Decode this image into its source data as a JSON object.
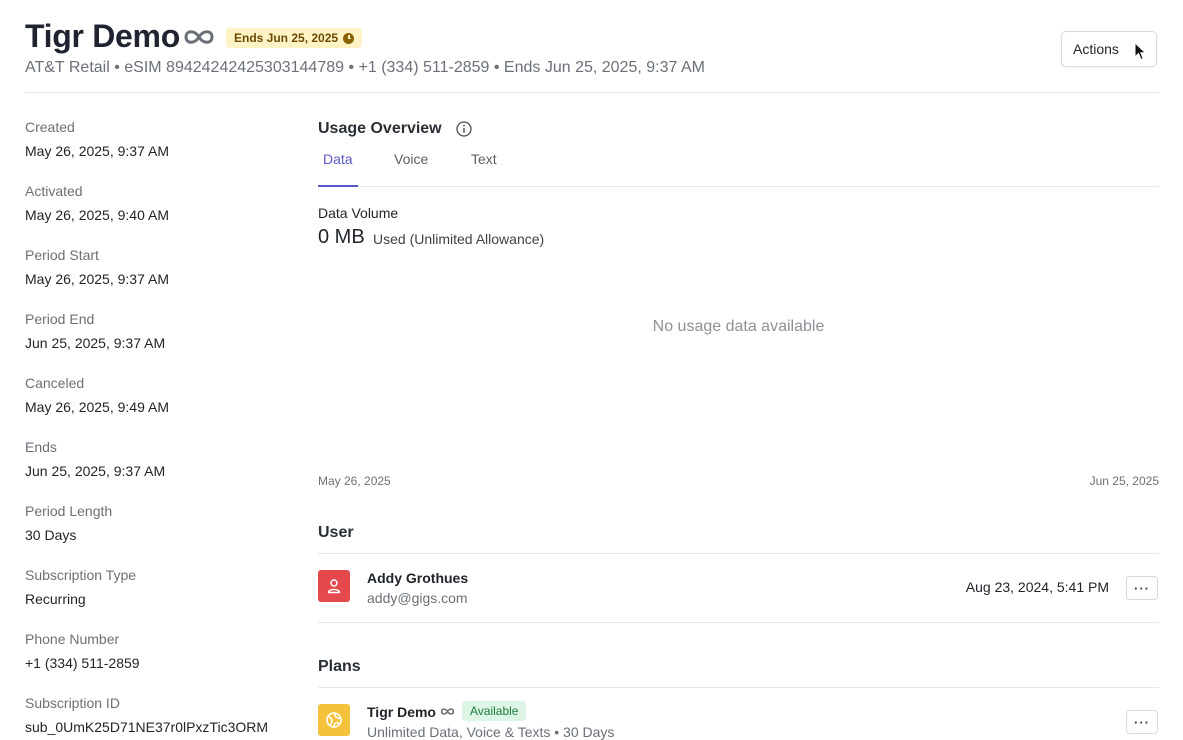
{
  "header": {
    "title": "Tigr Demo",
    "ends_badge": "Ends Jun 25, 2025",
    "subtitle": "AT&T Retail • eSIM 89424242425303144789 • +1 (334) 511-2859 •   Ends Jun 25, 2025, 9:37 AM",
    "actions_label": "Actions",
    "badge_color": "#fdf3c4"
  },
  "details": [
    {
      "label": "Created",
      "value": "May 26, 2025, 9:37 AM"
    },
    {
      "label": "Activated",
      "value": "May 26, 2025, 9:40 AM"
    },
    {
      "label": "Period Start",
      "value": "May 26, 2025, 9:37 AM"
    },
    {
      "label": "Period End",
      "value": "Jun 25, 2025, 9:37 AM"
    },
    {
      "label": "Canceled",
      "value": "May 26, 2025, 9:49 AM"
    },
    {
      "label": "Ends",
      "value": "Jun 25, 2025, 9:37 AM"
    },
    {
      "label": "Period Length",
      "value": "30 Days"
    },
    {
      "label": "Subscription Type",
      "value": "Recurring"
    },
    {
      "label": "Phone Number",
      "value": "+1 (334) 511-2859"
    },
    {
      "label": "Subscription ID",
      "value": "sub_0UmK25D71NE37r0lPxzTic3ORM"
    }
  ],
  "usage": {
    "title": "Usage Overview",
    "tabs": [
      {
        "label": "Data",
        "active": true
      },
      {
        "label": "Voice",
        "active": false
      },
      {
        "label": "Text",
        "active": false
      }
    ],
    "volume_label": "Data Volume",
    "volume_value": "0 MB",
    "volume_suffix": "Used (Unlimited Allowance)",
    "empty_message": "No usage data available",
    "axis_start": "May 26, 2025",
    "axis_end": "Jun 25, 2025",
    "accent_color": "#5b57c9"
  },
  "user_section": {
    "title": "User",
    "name": "Addy Grothues",
    "email": "addy@gigs.com",
    "date": "Aug 23, 2024, 5:41 PM",
    "more_label": "···",
    "avatar_color": "#e5484d"
  },
  "plans_section": {
    "title": "Plans",
    "name": "Tigr Demo",
    "status": "Available",
    "description": "Unlimited Data, Voice & Texts • 30 Days",
    "more_label": "···",
    "avatar_color": "#f5c33b",
    "status_color": "#dcf5e4"
  }
}
